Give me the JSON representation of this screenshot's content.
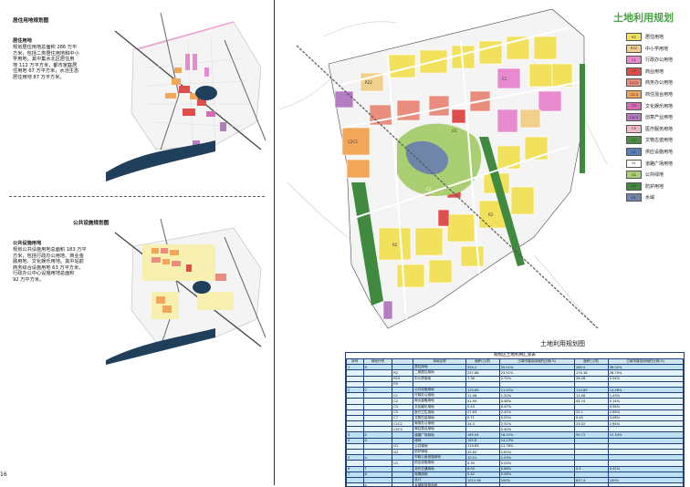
{
  "page": {
    "number": "16"
  },
  "inset_residential": {
    "title": "居住用地规划图",
    "heading": "居住用地",
    "lines": [
      "规划居住用地总面积 286 万平",
      "方米，包括二类居住用地和中小",
      "学用地。其中集水北区居住用",
      "地 112 万平方米，都市家庭居",
      "住用地 67 万平方米，水活生态",
      "居住用地 87 万平方米。"
    ]
  },
  "inset_public": {
    "title": "公共设施规划图",
    "heading": "公共设施用地",
    "lines": [
      "规划公共设施用地总面积 183 万平",
      "方米，包括行政办公用地、商业金",
      "融用地、文化娱乐用地。其中站前",
      "商务综合设施用地 63 万平方米，",
      "行政办公中心设施用地总面积",
      "92 万平方米。"
    ]
  },
  "main_map": {
    "title": "土地利用规划",
    "caption": "土地利用规划图",
    "legend": [
      {
        "code": "R2",
        "label": "居住用地",
        "color": "#f2e15c"
      },
      {
        "code": "R22",
        "label": "中小学用地",
        "color": "#f0d08a"
      },
      {
        "code": "C1",
        "label": "行政办公用地",
        "color": "#e88ad0"
      },
      {
        "code": "C2",
        "label": "商业用地",
        "color": "#e04d4d"
      },
      {
        "code": "C1C2",
        "label": "商务办公用地",
        "color": "#e98e7f"
      },
      {
        "code": "C2C3",
        "label": "商住混合用地",
        "color": "#f2a65a"
      },
      {
        "code": "C3",
        "label": "文化娱乐用地",
        "color": "#d66ab5"
      },
      {
        "code": "C1C3",
        "label": "创意产业用地",
        "color": "#b57cc4"
      },
      {
        "code": "C5",
        "label": "医疗服务用地",
        "color": "#f0b8c4"
      },
      {
        "code": "C7",
        "label": "文物古迹用地",
        "color": "#4e8c46"
      },
      {
        "code": "U1",
        "label": "供应设施用地",
        "color": "#5a7fb8"
      },
      {
        "code": "S1",
        "label": "道路广场用地",
        "color": "#ffffff"
      },
      {
        "code": "G1",
        "label": "公共绿地",
        "color": "#aacf72"
      },
      {
        "code": "G2",
        "label": "防护用地",
        "color": "#3f8a3f"
      },
      {
        "code": "E1",
        "label": "水域",
        "color": "#6f86aa"
      }
    ],
    "map_labels": [
      "R2",
      "R2",
      "C2",
      "C1",
      "C2C3",
      "R22",
      "G1",
      "C3",
      "G2",
      "R2",
      "C1C2",
      "R2",
      "S1"
    ]
  },
  "table": {
    "title": "规划区土地利用汇总表",
    "headers": [
      "序号",
      "用地代号",
      "",
      "用地名称",
      "面积(公顷)",
      "占城市建设用地的比例(%)",
      "面积(公顷)",
      "占城市建设用地的比例(%)"
    ],
    "left_label": "城市建设用地",
    "rows": [
      [
        "1",
        "R",
        "",
        "居住用地",
        "354.2",
        "35.01%",
        "264.5",
        "36.02%"
      ],
      [
        "",
        "",
        "R2",
        "二类居住用地",
        "237.88",
        "23.51%",
        "174.18",
        "28.70%"
      ],
      [
        "",
        "",
        "R22",
        "中小学用地",
        "7.36",
        "2.72%",
        "26.28",
        "2.54%"
      ],
      [
        "",
        "",
        "R3",
        "",
        "",
        "",
        "",
        ""
      ],
      [
        "2",
        "C",
        "",
        "公共设施用地",
        "115.69",
        "11.42%",
        "110.89",
        "14.58%"
      ],
      [
        "",
        "",
        "C1",
        "行政办公用地",
        "11.48",
        "1.20%",
        "11.08",
        "1.43%"
      ],
      [
        "",
        "",
        "C2",
        "商业金融用地",
        "41.94",
        "4.48%",
        "43.74",
        "5.14%"
      ],
      [
        "",
        "",
        "C3",
        "文化娱乐用地",
        "5.43",
        "0.47%",
        "",
        "0.56%"
      ],
      [
        "",
        "",
        "C5",
        "医疗卫生用地",
        "27.63",
        "2.45%",
        "25.1",
        "2.86%"
      ],
      [
        "",
        "",
        "C7",
        "文物古迹用地",
        "0.71",
        "0.05%",
        "0.45",
        "0.08%"
      ],
      [
        "",
        "",
        "C1C2",
        "商务办公用地",
        "24.3",
        "2.31%",
        "23.02",
        "2.64%"
      ],
      [
        "",
        "",
        "C2C3",
        "商住混合用地",
        "",
        "0.40%",
        "",
        ""
      ],
      [
        "3",
        "S",
        "",
        "道路广场用地",
        "165.04",
        "16.42%",
        "99.72",
        "15.33%"
      ],
      [
        "4",
        "G",
        "",
        "绿地",
        "145.8",
        "14.13%",
        "",
        ""
      ],
      [
        "",
        "",
        "G1",
        "公共绿地",
        "119.83",
        "11.78%",
        "",
        ""
      ],
      [
        "",
        "",
        "G2",
        "防护绿地",
        "25.82",
        "2.63%",
        "",
        ""
      ],
      [
        "5",
        "U",
        "",
        "市政公用设施用地",
        "10.51",
        "1.03%",
        "",
        ""
      ],
      [
        "",
        "",
        "U1",
        "供应设施用地",
        "0.35",
        "0.03%",
        "",
        ""
      ],
      [
        "6",
        "T",
        "",
        "对外交通用地",
        "6.99",
        "0.68%",
        "5.5",
        "0.42%"
      ],
      [
        "7",
        "D",
        "",
        "特殊用地",
        "0.42",
        "0.06%",
        "",
        ""
      ],
      [
        "",
        "",
        "",
        "合计",
        "1012.36",
        "100%",
        "827.4",
        "100%"
      ],
      [
        "",
        "E",
        "",
        "水域和其他用地",
        "",
        "",
        "",
        ""
      ],
      [
        "",
        "",
        "E1",
        "水域",
        "43.55",
        "—",
        "",
        ""
      ],
      [
        "",
        "",
        "",
        "总计",
        "1055.91",
        "—",
        "",
        ""
      ]
    ]
  }
}
